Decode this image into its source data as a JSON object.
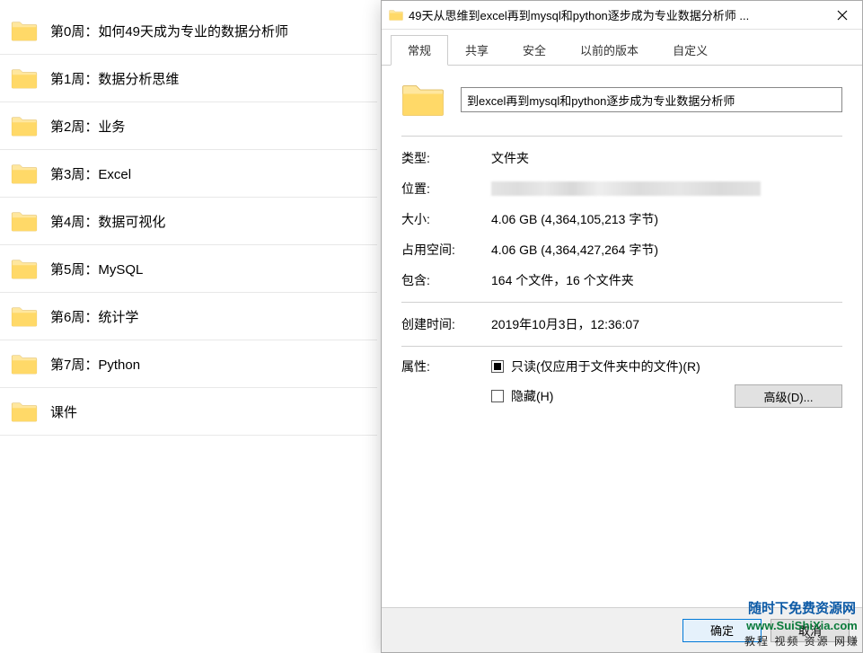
{
  "file_list": [
    {
      "label": "第0周：如何49天成为专业的数据分析师"
    },
    {
      "label": "第1周：数据分析思维"
    },
    {
      "label": "第2周：业务"
    },
    {
      "label": "第3周：Excel"
    },
    {
      "label": "第4周：数据可视化"
    },
    {
      "label": "第5周：MySQL"
    },
    {
      "label": "第6周：统计学"
    },
    {
      "label": "第7周：Python"
    },
    {
      "label": "课件"
    }
  ],
  "dialog": {
    "title": "49天从思维到excel再到mysql和python逐步成为专业数据分析师 ...",
    "tabs": [
      "常规",
      "共享",
      "安全",
      "以前的版本",
      "自定义"
    ],
    "folder_name": "到excel再到mysql和python逐步成为专业数据分析师",
    "labels": {
      "type": "类型:",
      "location": "位置:",
      "size": "大小:",
      "size_on_disk": "占用空间:",
      "contains": "包含:",
      "created": "创建时间:",
      "attributes": "属性:"
    },
    "values": {
      "type": "文件夹",
      "size": "4.06 GB (4,364,105,213 字节)",
      "size_on_disk": "4.06 GB (4,364,427,264 字节)",
      "contains": "164 个文件，16 个文件夹",
      "created": "2019年10月3日，12:36:07"
    },
    "attr": {
      "readonly": "只读(仅应用于文件夹中的文件)(R)",
      "hidden": "隐藏(H)",
      "advanced": "高级(D)..."
    },
    "buttons": {
      "ok": "确定",
      "cancel": "取消"
    }
  },
  "watermark": {
    "line1": "随时下免费资源网",
    "line2": "www.SuiShiXia.com",
    "line3": "教程 视频 资源 网赚"
  }
}
